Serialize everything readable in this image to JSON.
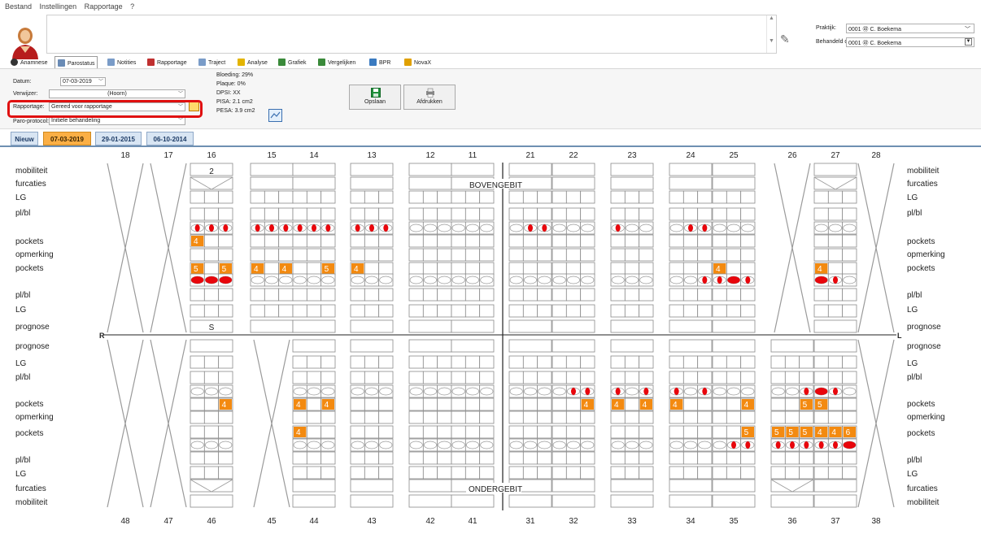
{
  "menu": [
    "Bestand",
    "Instellingen",
    "Rapportage",
    "?"
  ],
  "praktijk": {
    "label": "Praktijk:",
    "value": "0001 ㊞ C. Boekema"
  },
  "behandeld_door": {
    "label": "Behandeld door:",
    "value": "0001 ㊞ C. Boekema"
  },
  "tabs": [
    {
      "label": "Anamnese",
      "icon": "plus-circle-icon",
      "active": false
    },
    {
      "label": "Parostatus",
      "icon": "document-icon",
      "active": true
    },
    {
      "label": "Notities",
      "icon": "notes-icon",
      "active": false
    },
    {
      "label": "Rapportage",
      "icon": "pen-icon",
      "active": false
    },
    {
      "label": "Traject",
      "icon": "traject-icon",
      "active": false
    },
    {
      "label": "Analyse",
      "icon": "star-icon",
      "active": false
    },
    {
      "label": "Grafiek",
      "icon": "grafiek-icon",
      "active": false
    },
    {
      "label": "Vergelijken",
      "icon": "vergelijken-icon",
      "active": false
    },
    {
      "label": "BPR",
      "icon": "bpr-icon",
      "active": false
    },
    {
      "label": "NovaX",
      "icon": "novax-icon",
      "active": false
    }
  ],
  "form": {
    "datum_label": "Datum:",
    "datum": "07-03-2019",
    "verwijzer_label": "Verwijzer:",
    "verwijzer": "(Hoorn)",
    "rapportage_label": "Rapportage:",
    "rapportage": "Gereed voor rapportage",
    "paro_label": "Paro-protocol:",
    "paro": "Initiele behandeling"
  },
  "stats": [
    "Bloeding: 29%",
    "Plaque: 0%",
    "DPSI: XX",
    "PISA: 2.1 cm2",
    "PESA: 3.9 cm2"
  ],
  "buttons": {
    "opslaan": "Opslaan",
    "afdrukken": "Afdrukken"
  },
  "date_tabs": [
    {
      "label": "Nieuw",
      "active": false
    },
    {
      "label": "07-03-2019",
      "active": true
    },
    {
      "label": "29-01-2015",
      "active": false
    },
    {
      "label": "06-10-2014",
      "active": false
    }
  ],
  "chart": {
    "upper_teeth": [
      "18",
      "17",
      "16",
      "15",
      "14",
      "13",
      "12",
      "11",
      "21",
      "22",
      "23",
      "24",
      "25",
      "26",
      "27",
      "28"
    ],
    "lower_teeth": [
      "48",
      "47",
      "46",
      "45",
      "44",
      "43",
      "42",
      "41",
      "31",
      "32",
      "33",
      "34",
      "35",
      "36",
      "37",
      "38"
    ],
    "upper_labels_left": [
      "mobiliteit",
      "furcaties",
      "LG",
      "pl/bl",
      "pockets",
      "opmerking",
      "pockets",
      "pl/bl",
      "LG",
      "prognose"
    ],
    "upper_labels_right": [
      "mobiliteit",
      "furcaties",
      "LG",
      "pl/bl",
      "pockets",
      "opmerking",
      "pockets",
      "pl/bl",
      "LG",
      "prognose"
    ],
    "lower_labels_left": [
      "prognose",
      "LG",
      "pl/bl",
      "pockets",
      "opmerking",
      "pockets",
      "pl/bl",
      "LG",
      "furcaties",
      "mobiliteit"
    ],
    "lower_labels_right": [
      "prognose",
      "LG",
      "pl/bl",
      "pockets",
      "opmerking",
      "pockets",
      "pl/bl",
      "LG",
      "furcaties",
      "mobiliteit"
    ],
    "upper_jaw_label": "BOVENGEBIT",
    "lower_jaw_label": "ONDERGEBIT",
    "right_marker": "R",
    "left_marker": "L",
    "missing_upper": [
      "18",
      "17",
      "26",
      "28"
    ],
    "missing_lower": [
      "48",
      "47",
      "45",
      "38"
    ],
    "mobility_16": "2",
    "prognose_16": "S",
    "upper_buccal_pockets": {
      "16": [
        "4",
        "",
        ""
      ]
    },
    "upper_palatal_pockets": {
      "16": [
        "5",
        "",
        "5"
      ],
      "15": [
        "4",
        "",
        "4"
      ],
      "14": [
        "",
        "",
        "5"
      ],
      "13": [
        "4",
        "",
        ""
      ],
      "25": [
        "4",
        "",
        ""
      ],
      "27": [
        "4",
        "",
        ""
      ]
    },
    "upper_buccal_bleeding": {
      "16": [
        1,
        1,
        1
      ],
      "15": [
        1,
        1,
        1
      ],
      "14": [
        1,
        1,
        1
      ],
      "13": [
        1,
        1,
        1
      ],
      "21": [
        0,
        1,
        1
      ],
      "23": [
        1,
        0,
        0
      ],
      "24": [
        0,
        1,
        1
      ]
    },
    "upper_palatal_bleeding": {
      "16": [
        2,
        2,
        2
      ],
      "24": [
        0,
        0,
        1
      ],
      "25": [
        1,
        2,
        1
      ],
      "27": [
        2,
        1,
        0
      ]
    },
    "lower_buccal_pockets": {
      "46": [
        "",
        "",
        "4"
      ],
      "44": [
        "4",
        "",
        "4"
      ],
      "32": [
        "",
        "",
        "4"
      ],
      "33": [
        "4",
        "",
        "4"
      ],
      "34": [
        "4",
        "",
        ""
      ],
      "35": [
        "",
        "",
        "4"
      ],
      "36": [
        "",
        "",
        "5"
      ],
      "37": [
        "5",
        "",
        ""
      ]
    },
    "lower_lingual_pockets": {
      "44": [
        "4",
        "",
        ""
      ],
      "35": [
        "",
        "",
        "5"
      ],
      "36": [
        "5",
        "5",
        "5"
      ],
      "37": [
        "4",
        "4",
        "6"
      ]
    },
    "lower_buccal_bleeding": {
      "32": [
        0,
        1,
        1
      ],
      "33": [
        1,
        0,
        1
      ],
      "34": [
        1,
        0,
        1
      ],
      "36": [
        0,
        0,
        1
      ],
      "37": [
        2,
        1,
        0
      ]
    },
    "lower_lingual_bleeding": {
      "35": [
        0,
        1,
        1
      ],
      "36": [
        1,
        1,
        1
      ],
      "37": [
        1,
        1,
        2
      ]
    }
  },
  "colors": {
    "pocket_fill": "#f38a10",
    "bleeding": "#e8060c",
    "highlight": "#e01010",
    "active_date_tab": "#fbaf45"
  }
}
